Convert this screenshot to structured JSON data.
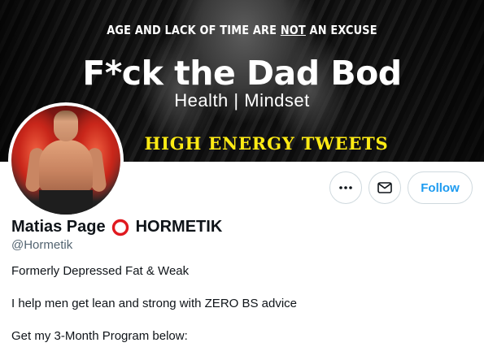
{
  "banner": {
    "tagline_part1": "AGE AND LACK OF TIME ARE ",
    "tagline_emph": "NOT",
    "tagline_part2": " AN EXCUSE",
    "headline": "F*ck the Dad Bod",
    "subline": "Health | Mindset",
    "energy": "HIGH ENERGY TWEETS",
    "accent_color": "#ffeb14"
  },
  "avatar": {
    "icon": "profile-photo-avatar"
  },
  "actions": {
    "more_icon": "more-horizontal-icon",
    "message_icon": "envelope-icon",
    "follow_label": "Follow"
  },
  "profile": {
    "name": "Matias Page",
    "name_emoji_icon": "hollow-red-circle-icon",
    "name_suffix": "HORMETIK",
    "handle": "@Hormetik",
    "bio": [
      "Formerly Depressed Fat & Weak",
      "I help men get lean and strong with ZERO BS advice",
      "Get my 3-Month Program below:"
    ]
  },
  "colors": {
    "link_blue": "#1d9bf0",
    "secondary_text": "#536471",
    "border": "#cfd9de",
    "ring_red": "#e0191f"
  }
}
